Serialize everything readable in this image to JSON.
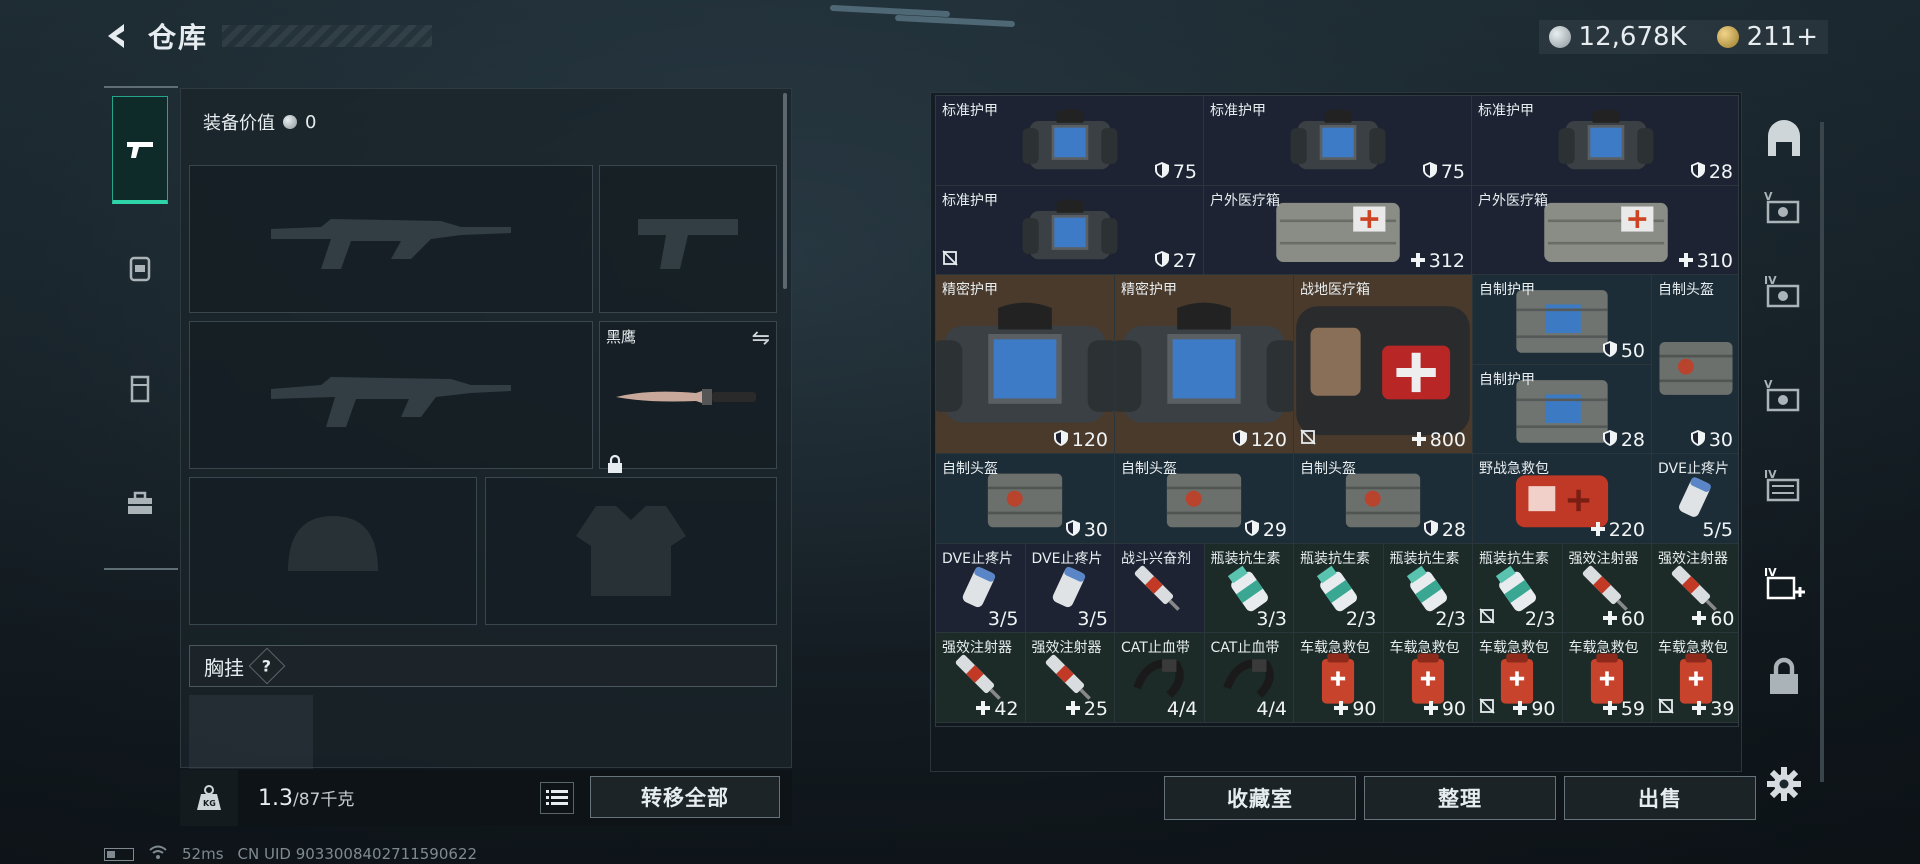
{
  "header": {
    "title": "仓库"
  },
  "currency": {
    "silver": "12,678K",
    "gold": "211+"
  },
  "equipment": {
    "value_label": "装备价值",
    "value": "0",
    "knife_name": "黑鹰",
    "chest_label": "胸挂",
    "help": "?"
  },
  "weight": {
    "current": "1.3",
    "max": "/87千克"
  },
  "buttons": {
    "transfer_all": "转移全部",
    "collection": "收藏室",
    "sort": "整理",
    "sell": "出售"
  },
  "status": {
    "ping": "52ms",
    "uid": "CN UID 9033008402711590622"
  },
  "colors": {
    "accent": "#2ed3a8",
    "armor_cell": "#1d2332",
    "med_cell": "#1c2a28",
    "orange_cell": "#4a3a2c",
    "blue_cell": "#1d2d38",
    "bandage_red": "#c23a25"
  },
  "storage": {
    "items": [
      {
        "name": "标准护甲",
        "value": "75",
        "icon": "shield-icon",
        "pic": "armor",
        "theme": "armor",
        "col": 0,
        "row": 0,
        "w": 1,
        "h": 1
      },
      {
        "name": "标准护甲",
        "value": "75",
        "icon": "shield-icon",
        "pic": "armor",
        "theme": "armor",
        "col": 1,
        "row": 0,
        "w": 1,
        "h": 1
      },
      {
        "name": "标准护甲",
        "value": "28",
        "icon": "shield-icon",
        "pic": "armor",
        "theme": "armor",
        "col": 2,
        "row": 0,
        "w": 1,
        "h": 1
      },
      {
        "name": "标准护甲",
        "value": "27",
        "icon": "shield-icon",
        "pic": "armor",
        "theme": "armor",
        "col": 0,
        "row": 1,
        "w": 1,
        "h": 1,
        "nolock": true
      },
      {
        "name": "户外医疗箱",
        "value": "312",
        "icon": "plus-icon",
        "pic": "medbag",
        "theme": "armor",
        "col": 1,
        "row": 1,
        "w": 1,
        "h": 1
      },
      {
        "name": "户外医疗箱",
        "value": "310",
        "icon": "plus-icon",
        "pic": "medbag",
        "theme": "armor",
        "col": 2,
        "row": 1,
        "w": 1,
        "h": 1
      },
      {
        "name": "精密护甲",
        "value": "120",
        "icon": "shield-icon",
        "pic": "armor",
        "theme": "orange",
        "col": 0,
        "row": 2,
        "w": 1,
        "h": 1
      },
      {
        "name": "精密护甲",
        "value": "120",
        "icon": "shield-icon",
        "pic": "armor",
        "theme": "orange",
        "col": 1,
        "row": 2,
        "w": 1,
        "h": 1
      },
      {
        "name": "战地医疗箱",
        "value": "800",
        "icon": "plus-icon",
        "pic": "firstaid",
        "theme": "orange",
        "col": 2,
        "row": 2,
        "w": 1,
        "h": 1,
        "nolock": true
      },
      {
        "name": "自制护甲",
        "value": "50",
        "icon": "shield-icon",
        "pic": "vest",
        "theme": "blue",
        "col": 3,
        "row": 2,
        "w": 1,
        "h": 0.5
      },
      {
        "name": "自制护甲",
        "value": "28",
        "icon": "shield-icon",
        "pic": "vest",
        "theme": "blue",
        "col": 3,
        "row": 2.5,
        "w": 1,
        "h": 0.5
      },
      {
        "name": "自制头盔",
        "value": "30",
        "icon": "shield-icon",
        "pic": "helmet",
        "theme": "blue",
        "col": 4,
        "row": 2,
        "w": 0.5,
        "h": 1
      },
      {
        "name": "自制头盔",
        "value": "30",
        "icon": "shield-icon",
        "pic": "helmet",
        "theme": "blue",
        "col": 0,
        "row": 3,
        "w": 1,
        "h": 1
      },
      {
        "name": "自制头盔",
        "value": "29",
        "icon": "shield-icon",
        "pic": "helmet",
        "theme": "blue",
        "col": 1,
        "row": 3,
        "w": 1,
        "h": 1
      },
      {
        "name": "自制头盔",
        "value": "28",
        "icon": "shield-icon",
        "pic": "helmet",
        "theme": "blue",
        "col": 2,
        "row": 3,
        "w": 1,
        "h": 1
      },
      {
        "name": "野战急救包",
        "value": "220",
        "icon": "plus-icon",
        "pic": "redkit",
        "theme": "blue",
        "col": 3,
        "row": 3,
        "w": 1,
        "h": 1
      },
      {
        "name": "DVE止疼片",
        "value": "5/5",
        "icon": "",
        "pic": "pill",
        "theme": "blue",
        "col": 4,
        "row": 3,
        "w": 0.5,
        "h": 1
      }
    ],
    "small": [
      {
        "name": "DVE止疼片",
        "value": "3/5",
        "icon": "",
        "pic": "pill",
        "theme": "armor"
      },
      {
        "name": "DVE止疼片",
        "value": "3/5",
        "icon": "",
        "pic": "pill",
        "theme": "armor"
      },
      {
        "name": "战斗兴奋剂",
        "value": "",
        "icon": "",
        "pic": "syringe",
        "theme": "armor"
      },
      {
        "name": "瓶装抗生素",
        "value": "3/3",
        "icon": "",
        "pic": "bottle",
        "theme": "med"
      },
      {
        "name": "瓶装抗生素",
        "value": "2/3",
        "icon": "",
        "pic": "bottle",
        "theme": "med"
      },
      {
        "name": "瓶装抗生素",
        "value": "2/3",
        "icon": "",
        "pic": "bottle",
        "theme": "med"
      },
      {
        "name": "瓶装抗生素",
        "value": "2/3",
        "icon": "",
        "pic": "bottle",
        "theme": "med",
        "nolock": true
      },
      {
        "name": "强效注射器",
        "value": "60",
        "icon": "plus-icon",
        "pic": "syringe",
        "theme": "med"
      },
      {
        "name": "强效注射器",
        "value": "60",
        "icon": "plus-icon",
        "pic": "syringe",
        "theme": "med"
      },
      {
        "name": "强效注射器",
        "value": "42",
        "icon": "plus-icon",
        "pic": "syringe",
        "theme": "med"
      },
      {
        "name": "强效注射器",
        "value": "25",
        "icon": "plus-icon",
        "pic": "syringe",
        "theme": "med"
      },
      {
        "name": "CAT止血带",
        "value": "4/4",
        "icon": "",
        "pic": "tourniquet",
        "theme": "med"
      },
      {
        "name": "CAT止血带",
        "value": "4/4",
        "icon": "",
        "pic": "tourniquet",
        "theme": "med"
      },
      {
        "name": "车载急救包",
        "value": "90",
        "icon": "plus-icon",
        "pic": "pouch",
        "theme": "med"
      },
      {
        "name": "车载急救包",
        "value": "90",
        "icon": "plus-icon",
        "pic": "pouch",
        "theme": "med"
      },
      {
        "name": "车载急救包",
        "value": "90",
        "icon": "plus-icon",
        "pic": "pouch",
        "theme": "med",
        "nolock": true
      },
      {
        "name": "车载急救包",
        "value": "59",
        "icon": "plus-icon",
        "pic": "pouch",
        "theme": "med"
      },
      {
        "name": "车载急救包",
        "value": "39",
        "icon": "plus-icon",
        "pic": "pouch",
        "theme": "med",
        "nolock": true
      }
    ]
  }
}
